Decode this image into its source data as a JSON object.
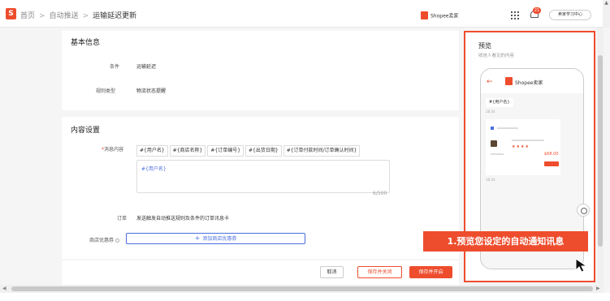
{
  "header": {
    "logo_glyph": "S",
    "breadcrumbs": [
      "首页",
      "自动推送",
      "运输延迟更新"
    ],
    "separator": ">",
    "shop_name": "Shopee卖家",
    "notification_count": "21",
    "learn_button": "卖家学习中心"
  },
  "basic_info": {
    "title": "基本信息",
    "condition_label": "条件",
    "condition_value": "运输延迟",
    "rule_type_label": "规则类型",
    "rule_type_value": "物流状态提醒"
  },
  "content_settings": {
    "title": "内容设置",
    "required_mark": "*",
    "message_label": "消息内容",
    "variable_tags": [
      "#{用户名}",
      "#{商店名称}",
      "#{订单编号}",
      "#{出货日期}",
      "#{订单付款时间/订单确认时间}"
    ],
    "editor_value": "#{用户名}",
    "counter": "6/500",
    "order_label": "订单",
    "order_value": "发送触发自动推送规则及条件的订单讯息卡",
    "coupon_label": "商店优惠券",
    "coupon_help_icon": "help-circle-icon",
    "coupon_button_plus": "+",
    "coupon_button": "添加商店优惠券"
  },
  "footer": {
    "cancel": "取消",
    "save_close": "保存并关闭",
    "save_open": "保存并开启"
  },
  "preview": {
    "title": "预览",
    "subtitle": "收信人看见的内容",
    "back_arrow": "←",
    "shop_name": "Shopee卖家",
    "user_tag": "#{用户名}",
    "time1": "18:24",
    "time2": "18:24",
    "stars": "★★★★",
    "price": "$68.00"
  },
  "callout": "1.预览您设定的自动通知讯息",
  "scroll": {
    "up": "▲",
    "left": "◀",
    "right": "▶"
  },
  "colors": {
    "accent": "#ee4d2d",
    "link": "#4a6ee0"
  }
}
